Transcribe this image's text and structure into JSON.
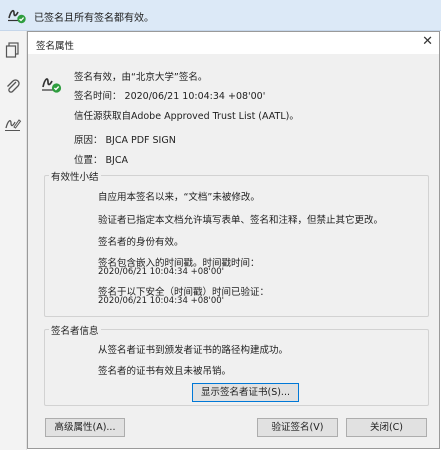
{
  "banner": {
    "text": "已签名且所有签名都有效。"
  },
  "dialog": {
    "title": "签名属性",
    "summary": {
      "valid_by": "签名有效，由“北京大学”签名。",
      "sign_time": "签名时间： 2020/06/21 10:04:34 +08'00'",
      "trust_source": "信任源获取自Adobe Approved Trust List (AATL)。",
      "reason": "原因： BJCA PDF SIGN",
      "location": "位置： BJCA"
    },
    "validity": {
      "legend": "有效性小结",
      "items": [
        "自应用本签名以来，“文档”未被修改。",
        "验证者已指定本文档允许填写表单、签名和注释，但禁止其它更改。",
        "签名者的身份有效。",
        "签名包含嵌入的时间戳。时间戳时间：",
        "2020/06/21 10:04:34 +08'00'",
        "签名于以下安全（时间戳）时间已验证：",
        "2020/06/21 10:04:34 +08'00'"
      ]
    },
    "signer": {
      "legend": "签名者信息",
      "items": [
        "从签名者证书到颁发者证书的路径构建成功。",
        "签名者的证书有效且未被吊销。"
      ],
      "show_cert_button": "显示签名者证书(S)..."
    },
    "buttons": {
      "advanced": "高级属性(A)...",
      "validate": "验证签名(V)",
      "close": "关闭(C)"
    }
  }
}
